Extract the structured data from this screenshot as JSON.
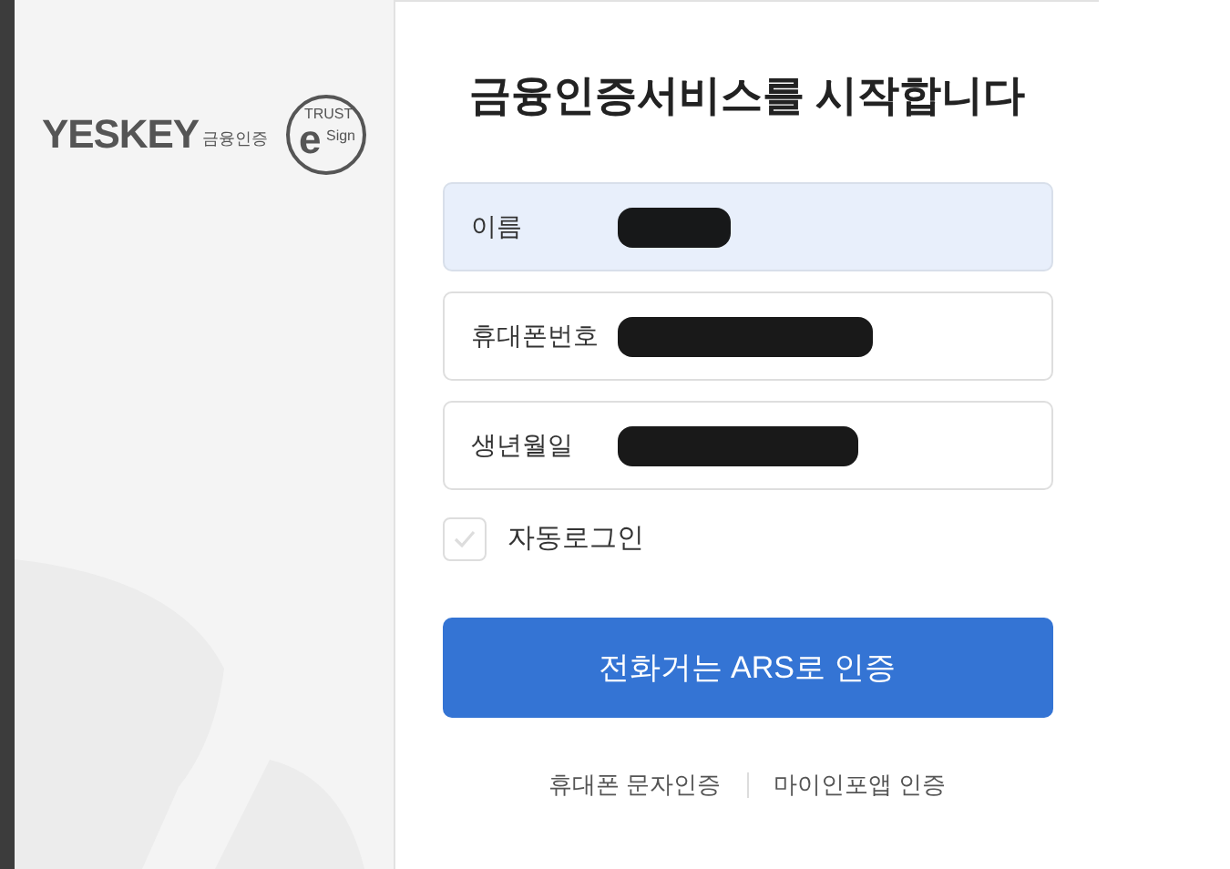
{
  "logo": {
    "wordmark": "YESKEY",
    "subtitle": "금융인증",
    "seal_top": "TRUST",
    "seal_letter": "e",
    "seal_side": "Sign"
  },
  "title": "금융인증서비스를 시작합니다",
  "fields": [
    {
      "label": "이름",
      "selected": true
    },
    {
      "label": "휴대폰번호",
      "selected": false
    },
    {
      "label": "생년월일",
      "selected": false
    }
  ],
  "auto_login": {
    "label": "자동로그인",
    "checked": false
  },
  "submit_button": "전화거는 ARS로 인증",
  "alt_links": [
    "휴대폰 문자인증",
    "마이인포앱 인증"
  ]
}
